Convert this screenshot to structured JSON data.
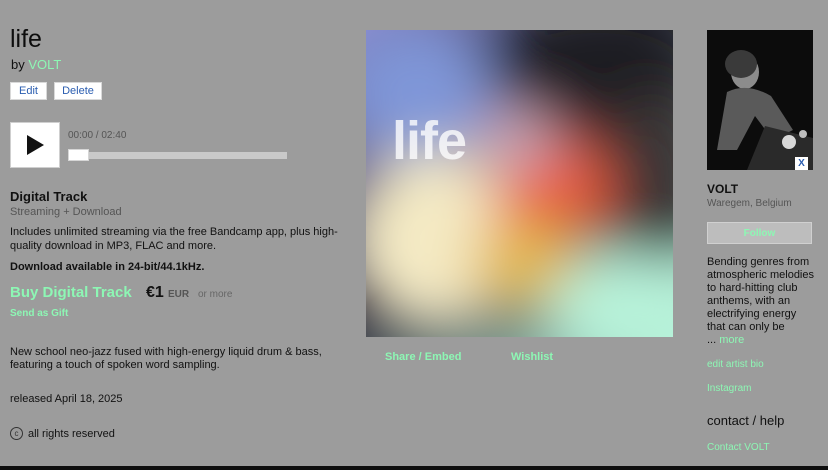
{
  "album": {
    "title": "life",
    "by_prefix": "by",
    "artist": "VOLT",
    "cover_text": "life"
  },
  "admin": {
    "edit_label": "Edit",
    "delete_label": "Delete"
  },
  "player": {
    "time": "00:00 / 02:40",
    "progress": 0.0,
    "play_icon": "play-icon"
  },
  "purchase": {
    "heading": "Digital Track",
    "subheading": "Streaming + Download",
    "description": "Includes unlimited streaming via the free Bandcamp app, plus high-quality download in MP3, FLAC and more.",
    "download_note": "Download available in 24-bit/44.1kHz.",
    "buy_label": "Buy Digital Track",
    "price": "€1",
    "currency": "EUR",
    "or_more": "or more",
    "gift_label": "Send as Gift"
  },
  "about": "New school neo-jazz fused with high-energy liquid drum & bass, featuring a touch of spoken word sampling.",
  "released": "released April 18, 2025",
  "rights": "all rights reserved",
  "actions": {
    "share_label": "Share / Embed",
    "wishlist_label": "Wishlist"
  },
  "sidebar": {
    "artist_name": "VOLT",
    "location": "Waregem, Belgium",
    "follow_label": "Follow",
    "bio": "Bending genres from atmospheric melodies to hard-hitting club anthems, with an electrifying energy that can only be",
    "bio_ellipsis": "...",
    "more_label": "more",
    "edit_bio_label": "edit artist bio",
    "instagram_label": "Instagram",
    "contact_heading": "contact / help",
    "contact_label": "Contact VOLT",
    "badge_label": "X"
  },
  "colors": {
    "accent": "#8df7b4",
    "background": "#9c9c9c"
  }
}
